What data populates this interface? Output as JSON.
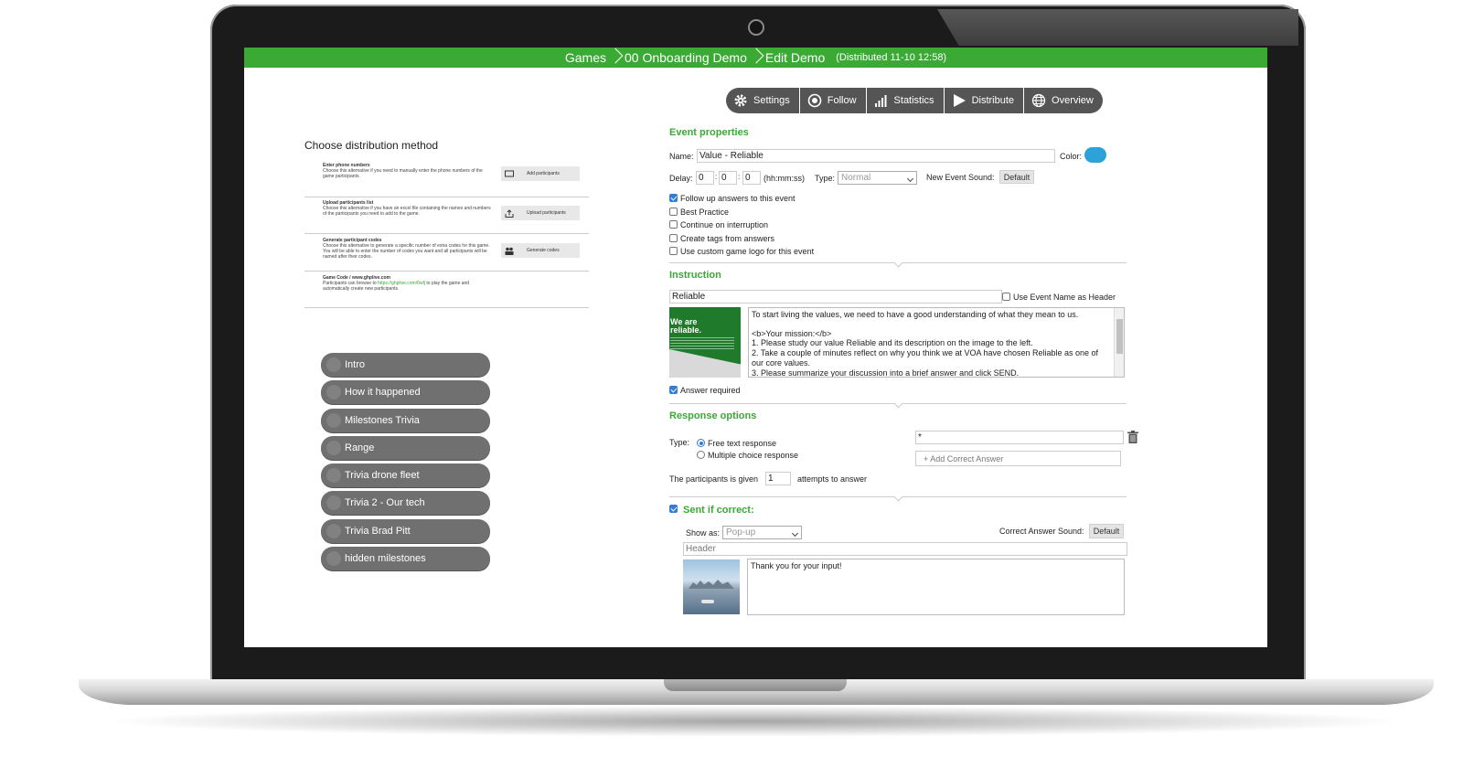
{
  "breadcrumb": {
    "items": [
      "Games",
      "00 Onboarding Demo",
      "Edit Demo"
    ],
    "subtitle": "(Distributed 11-10 12:58)"
  },
  "toolbar": {
    "settings": "Settings",
    "follow": "Follow",
    "statistics": "Statistics",
    "distribute": "Distribute",
    "overview": "Overview"
  },
  "distribution": {
    "title": "Choose distribution method",
    "items": [
      {
        "title": "Enter phone numbers",
        "desc": "Choose this alternative if you need to manually enter the phone numbers of the game participants.",
        "button": "Add participants"
      },
      {
        "title": "Upload participants list",
        "desc": "Choose this alternative if you have an excel file containing the names and numbers of the participants you need to add to the game.",
        "button": "Upload participants"
      },
      {
        "title": "Generate participant codes",
        "desc": "Choose this alternative to generate a specific number of extra codes for this game. You will be able to enter the number of codes you want and all participants will be named after their codes.",
        "button": "Generate codes"
      },
      {
        "title": "Game Code / www.ghplive.com",
        "desc_prefix": "Participants can browse to ",
        "desc_link": "https://ghplive.com/0wfj",
        "desc_suffix": " to play the game and automatically create new participants."
      }
    ]
  },
  "events": [
    "Intro",
    "How it happened",
    "Milestones Trivia",
    "Range",
    "Trivia drone fleet",
    "Trivia 2 - Our tech",
    "Trivia Brad Pitt",
    "hidden milestones"
  ],
  "event_properties": {
    "heading": "Event properties",
    "name_label": "Name:",
    "name_value": "Value - Reliable",
    "color_label": "Color:",
    "color_value": "#2ba3d9",
    "delay_label": "Delay:",
    "delay_h": "0",
    "delay_m": "0",
    "delay_s": "0",
    "delay_unit": "(hh:mm:ss)",
    "type_label": "Type:",
    "type_value": "Normal",
    "sound_label": "New Event Sound:",
    "sound_button": "Default",
    "checkboxes": [
      {
        "label": "Follow up answers to this event",
        "checked": true
      },
      {
        "label": "Best Practice",
        "checked": false
      },
      {
        "label": "Continue on interruption",
        "checked": false
      },
      {
        "label": "Create tags from answers",
        "checked": false
      },
      {
        "label": "Use custom game logo for this event",
        "checked": false
      }
    ]
  },
  "instruction": {
    "heading": "Instruction",
    "title_value": "Reliable",
    "use_name_label": "Use Event Name as Header",
    "image_text_1": "We are",
    "image_text_2": "reliable.",
    "body_lines": [
      "To start living the values, we need to have a good understanding of what they mean to us.",
      "",
      "<b>Your mission:</b>",
      "1. Please study our value Reliable and its description on the image to the left.",
      "2. Take a couple of minutes reflect on why you think we at VOA have chosen Reliable as one of our core values.",
      "3. Please summarize your discussion into a brief answer and click SEND."
    ],
    "answer_required_label": "Answer required"
  },
  "response": {
    "heading": "Response options",
    "type_label": "Type:",
    "option_free": "Free text response",
    "option_multi": "Multiple choice response",
    "answer_value": "*",
    "add_correct": "+ Add Correct Answer",
    "attempts_prefix": "The participants is given",
    "attempts_value": "1",
    "attempts_suffix": "attempts to answer"
  },
  "sent_if_correct": {
    "heading": "Sent if correct:",
    "show_as_label": "Show as:",
    "show_as_value": "Pop-up",
    "sound_label": "Correct Answer Sound:",
    "sound_button": "Default",
    "header_placeholder": "Header",
    "message": "Thank you for your input!"
  },
  "colors": {
    "green": "#3aaa35",
    "pill": "#707070",
    "toolbar": "#555555"
  }
}
